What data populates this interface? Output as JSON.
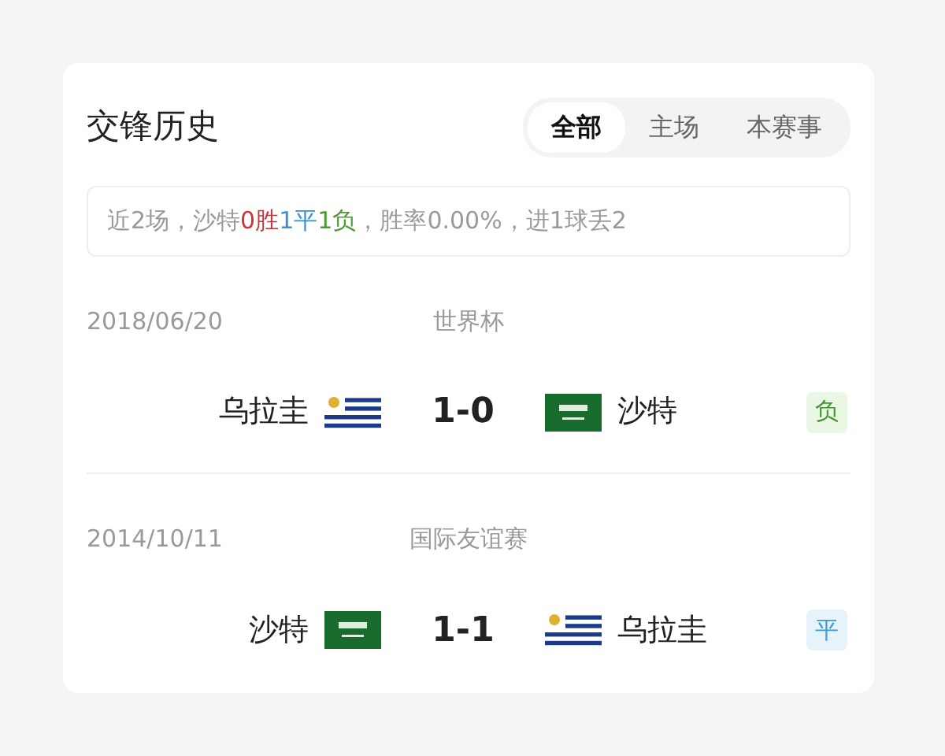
{
  "title": "交锋历史",
  "tabs": [
    {
      "label": "全部",
      "selected": true
    },
    {
      "label": "主场",
      "selected": false
    },
    {
      "label": "本赛事",
      "selected": false
    }
  ],
  "summary": [
    {
      "text": "近2场，沙特"
    },
    {
      "text": "0胜",
      "color": "#c8343d"
    },
    {
      "text": "1平",
      "color": "#3b8fd6"
    },
    {
      "text": "1负",
      "color": "#4a9a2e"
    },
    {
      "text": "，胜率0.00%，进1球丢2"
    }
  ],
  "matches": [
    {
      "date": "2018/06/20",
      "competition": "世界杯",
      "home": {
        "name": "乌拉圭",
        "kind": "uruguay"
      },
      "score": "1-0",
      "away": {
        "name": "沙特",
        "kind": "saudi"
      },
      "result": {
        "text": "负",
        "kind": "loss"
      }
    },
    {
      "date": "2014/10/11",
      "competition": "国际友谊赛",
      "home": {
        "name": "沙特",
        "kind": "saudi"
      },
      "score": "1-1",
      "away": {
        "name": "乌拉圭",
        "kind": "uruguay"
      },
      "result": {
        "text": "平",
        "kind": "draw"
      }
    }
  ]
}
